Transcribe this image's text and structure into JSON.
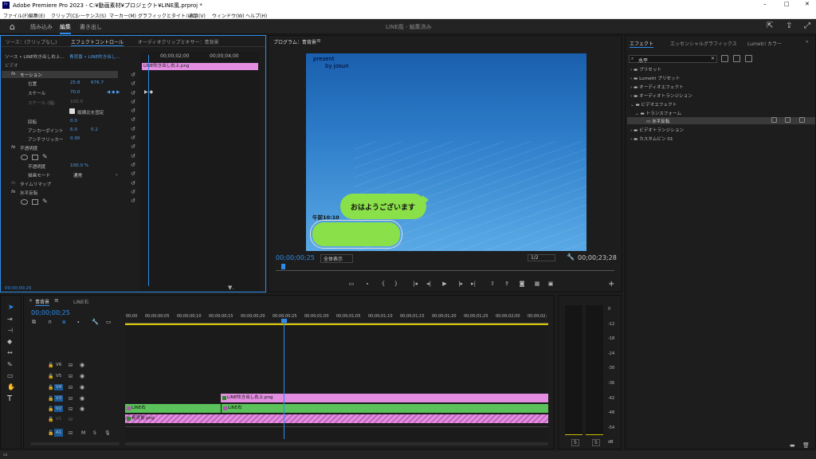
{
  "titlebar": {
    "title": "Adobe Premiere Pro 2023 - C:¥動画素材¥プロジェクト¥LINE風.prproj *",
    "min": "–",
    "max": "□",
    "close": "✕"
  },
  "menus": [
    "ファイル(F)",
    "編集(E)",
    "クリップ(C)",
    "シーケンス(S)",
    "マーカー(M)",
    "グラフィックとタイトル(G)",
    "表示(V)",
    "ウィンドウ(W)",
    "ヘルプ(H)"
  ],
  "workspace": {
    "tabs": [
      "読み込み",
      "編集",
      "書き出し"
    ],
    "center": "LINE風 - 編集済み"
  },
  "effect_controls": {
    "tabs": [
      "ソース：(クリップなし)",
      "エフェクトコントロール",
      "オーディオクリップミキサー：青背景"
    ],
    "source_row": "ソース • LINE吹き出し右上...",
    "seq_row": "青背景 • LINE吹き出し...",
    "section_video": "ビデオ",
    "times": [
      "00;00;02;00",
      "00;00;04;00"
    ],
    "clip_label": "LINE吹き出し右上.png",
    "props": [
      {
        "name": "モーション",
        "v1": "",
        "v2": ""
      },
      {
        "name": "位置",
        "v1": "25.8",
        "v2": "676.7"
      },
      {
        "name": "スケール",
        "v1": "70.0",
        "v2": ""
      },
      {
        "name": "スケール (幅)",
        "v1": "100.0",
        "v2": ""
      },
      {
        "name": "縦横比を固定",
        "v1": "",
        "v2": ""
      },
      {
        "name": "回転",
        "v1": "0.0",
        "v2": ""
      },
      {
        "name": "アンカーポイント",
        "v1": "6.0",
        "v2": "0.2"
      },
      {
        "name": "アンチフリッカー",
        "v1": "0.00",
        "v2": ""
      },
      {
        "name": "不透明度",
        "v1": "",
        "v2": ""
      },
      {
        "name": "不透明度",
        "v1": "100.0 %",
        "v2": ""
      },
      {
        "name": "描画モード",
        "v1": "通常",
        "v2": ""
      },
      {
        "name": "タイムリマップ",
        "v1": "",
        "v2": ""
      },
      {
        "name": "水平反転",
        "v1": "",
        "v2": ""
      }
    ],
    "timecode": "00;00;00;25"
  },
  "program": {
    "tab": "プログラム：青背景",
    "overlay_line1": "present",
    "overlay_line2": "by josun",
    "bubble_text": "おはようございます",
    "time_text": "午前10:10",
    "timecode": "00;00;00;25",
    "fit": "全体表示",
    "quality": "1/2",
    "duration": "00;00;23;28"
  },
  "effects": {
    "tabs": [
      "エフェクト",
      "エッセンシャルグラフィックス",
      "Lumetri カラー"
    ],
    "search": "水平",
    "tree": [
      {
        "label": "プリセット",
        "indent": 0
      },
      {
        "label": "Lumetri プリセット",
        "indent": 0
      },
      {
        "label": "オーディオエフェクト",
        "indent": 0
      },
      {
        "label": "オーディオトランジション",
        "indent": 0
      },
      {
        "label": "ビデオエフェクト",
        "indent": 0
      },
      {
        "label": "トランスフォーム",
        "indent": 1
      },
      {
        "label": "水平反転",
        "indent": 2
      },
      {
        "label": "ビデオトランジション",
        "indent": 0
      },
      {
        "label": "カスタムビン 01",
        "indent": 0
      }
    ]
  },
  "timeline": {
    "tabs": [
      "青背景",
      "LINE右"
    ],
    "timecode": "00;00;00;25",
    "ruler": [
      "00;00",
      "00;00;00;05",
      "00;00;00;10",
      "00;00;00;15",
      "00;00;00;20",
      "00;00;00;25",
      "00;00;01;00",
      "00;00;01;05",
      "00;00;01;10",
      "00;00;01;15",
      "00;00;01;20",
      "00;00;01;25",
      "00;00;02;00",
      "00;00;02;"
    ],
    "tracks": [
      "V6",
      "V5",
      "V4",
      "V3",
      "V2",
      "V1",
      "A1"
    ],
    "clips": {
      "v3": "LINE吹き出し右上.png",
      "v2a": "LINE右",
      "v2b": "LINE右",
      "v1": "青背景.png"
    },
    "a1_labels": [
      "M",
      "S"
    ]
  },
  "meter": {
    "scale": [
      "0",
      "-12",
      "-18",
      "-24",
      "-30",
      "-36",
      "-42",
      "-48",
      "-54",
      "dB"
    ],
    "solo": [
      "S",
      "S"
    ]
  },
  "colors": {
    "accent": "#2d8ceb",
    "clip_pink": "#e38ee0",
    "clip_green": "#5bc15b",
    "bubble": "#8ae048"
  }
}
